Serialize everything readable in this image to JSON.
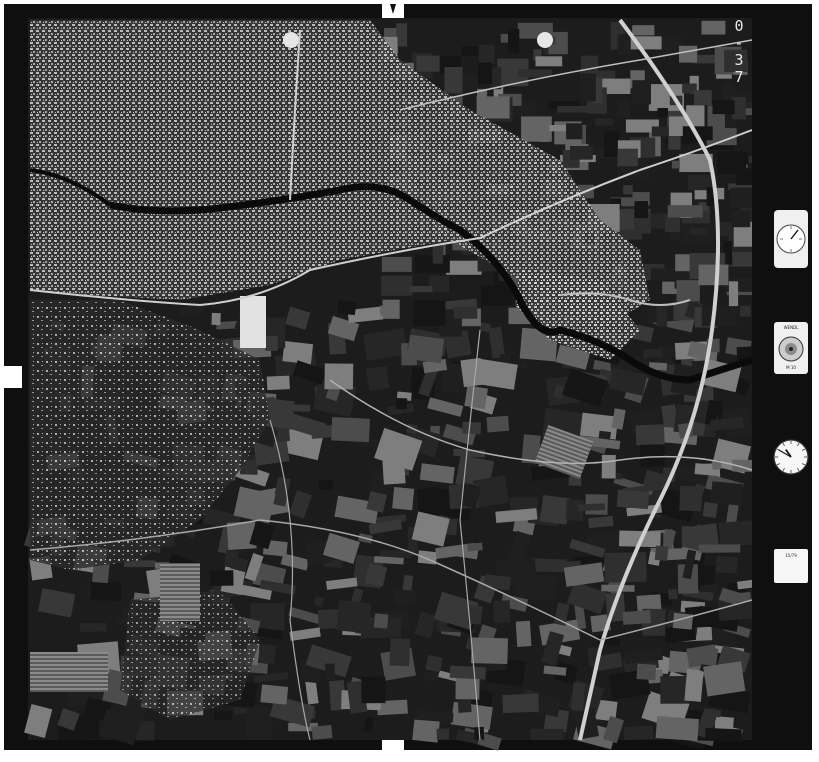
{
  "photo": {
    "frame_id": "0-37",
    "fiducial_marks": 4,
    "tone": "black-and-white",
    "colors": {
      "frame": "#0f0f0f",
      "image_dark": "#1c1c1c",
      "image_light": "#bfbfbf",
      "panel": "#f4f4f4"
    }
  },
  "instruments": {
    "altimeter": {
      "icon": "altimeter-gauge-icon"
    },
    "lens_badge": {
      "icon": "lens-badge-icon",
      "line1": "WENDL ",
      "line2": "M 10 "
    },
    "clock": {
      "icon": "clock-icon",
      "hour": 10,
      "minute": 50
    },
    "data_tag": {
      "icon": "data-tag-icon",
      "line1": "15/79",
      "line2": "",
      "line3": ""
    }
  },
  "features": {
    "city": "dense urban area, upper left",
    "motorway": "curved highway on the east side",
    "river": "meandering river through the centre",
    "fields": "patchwork of agricultural fields"
  }
}
